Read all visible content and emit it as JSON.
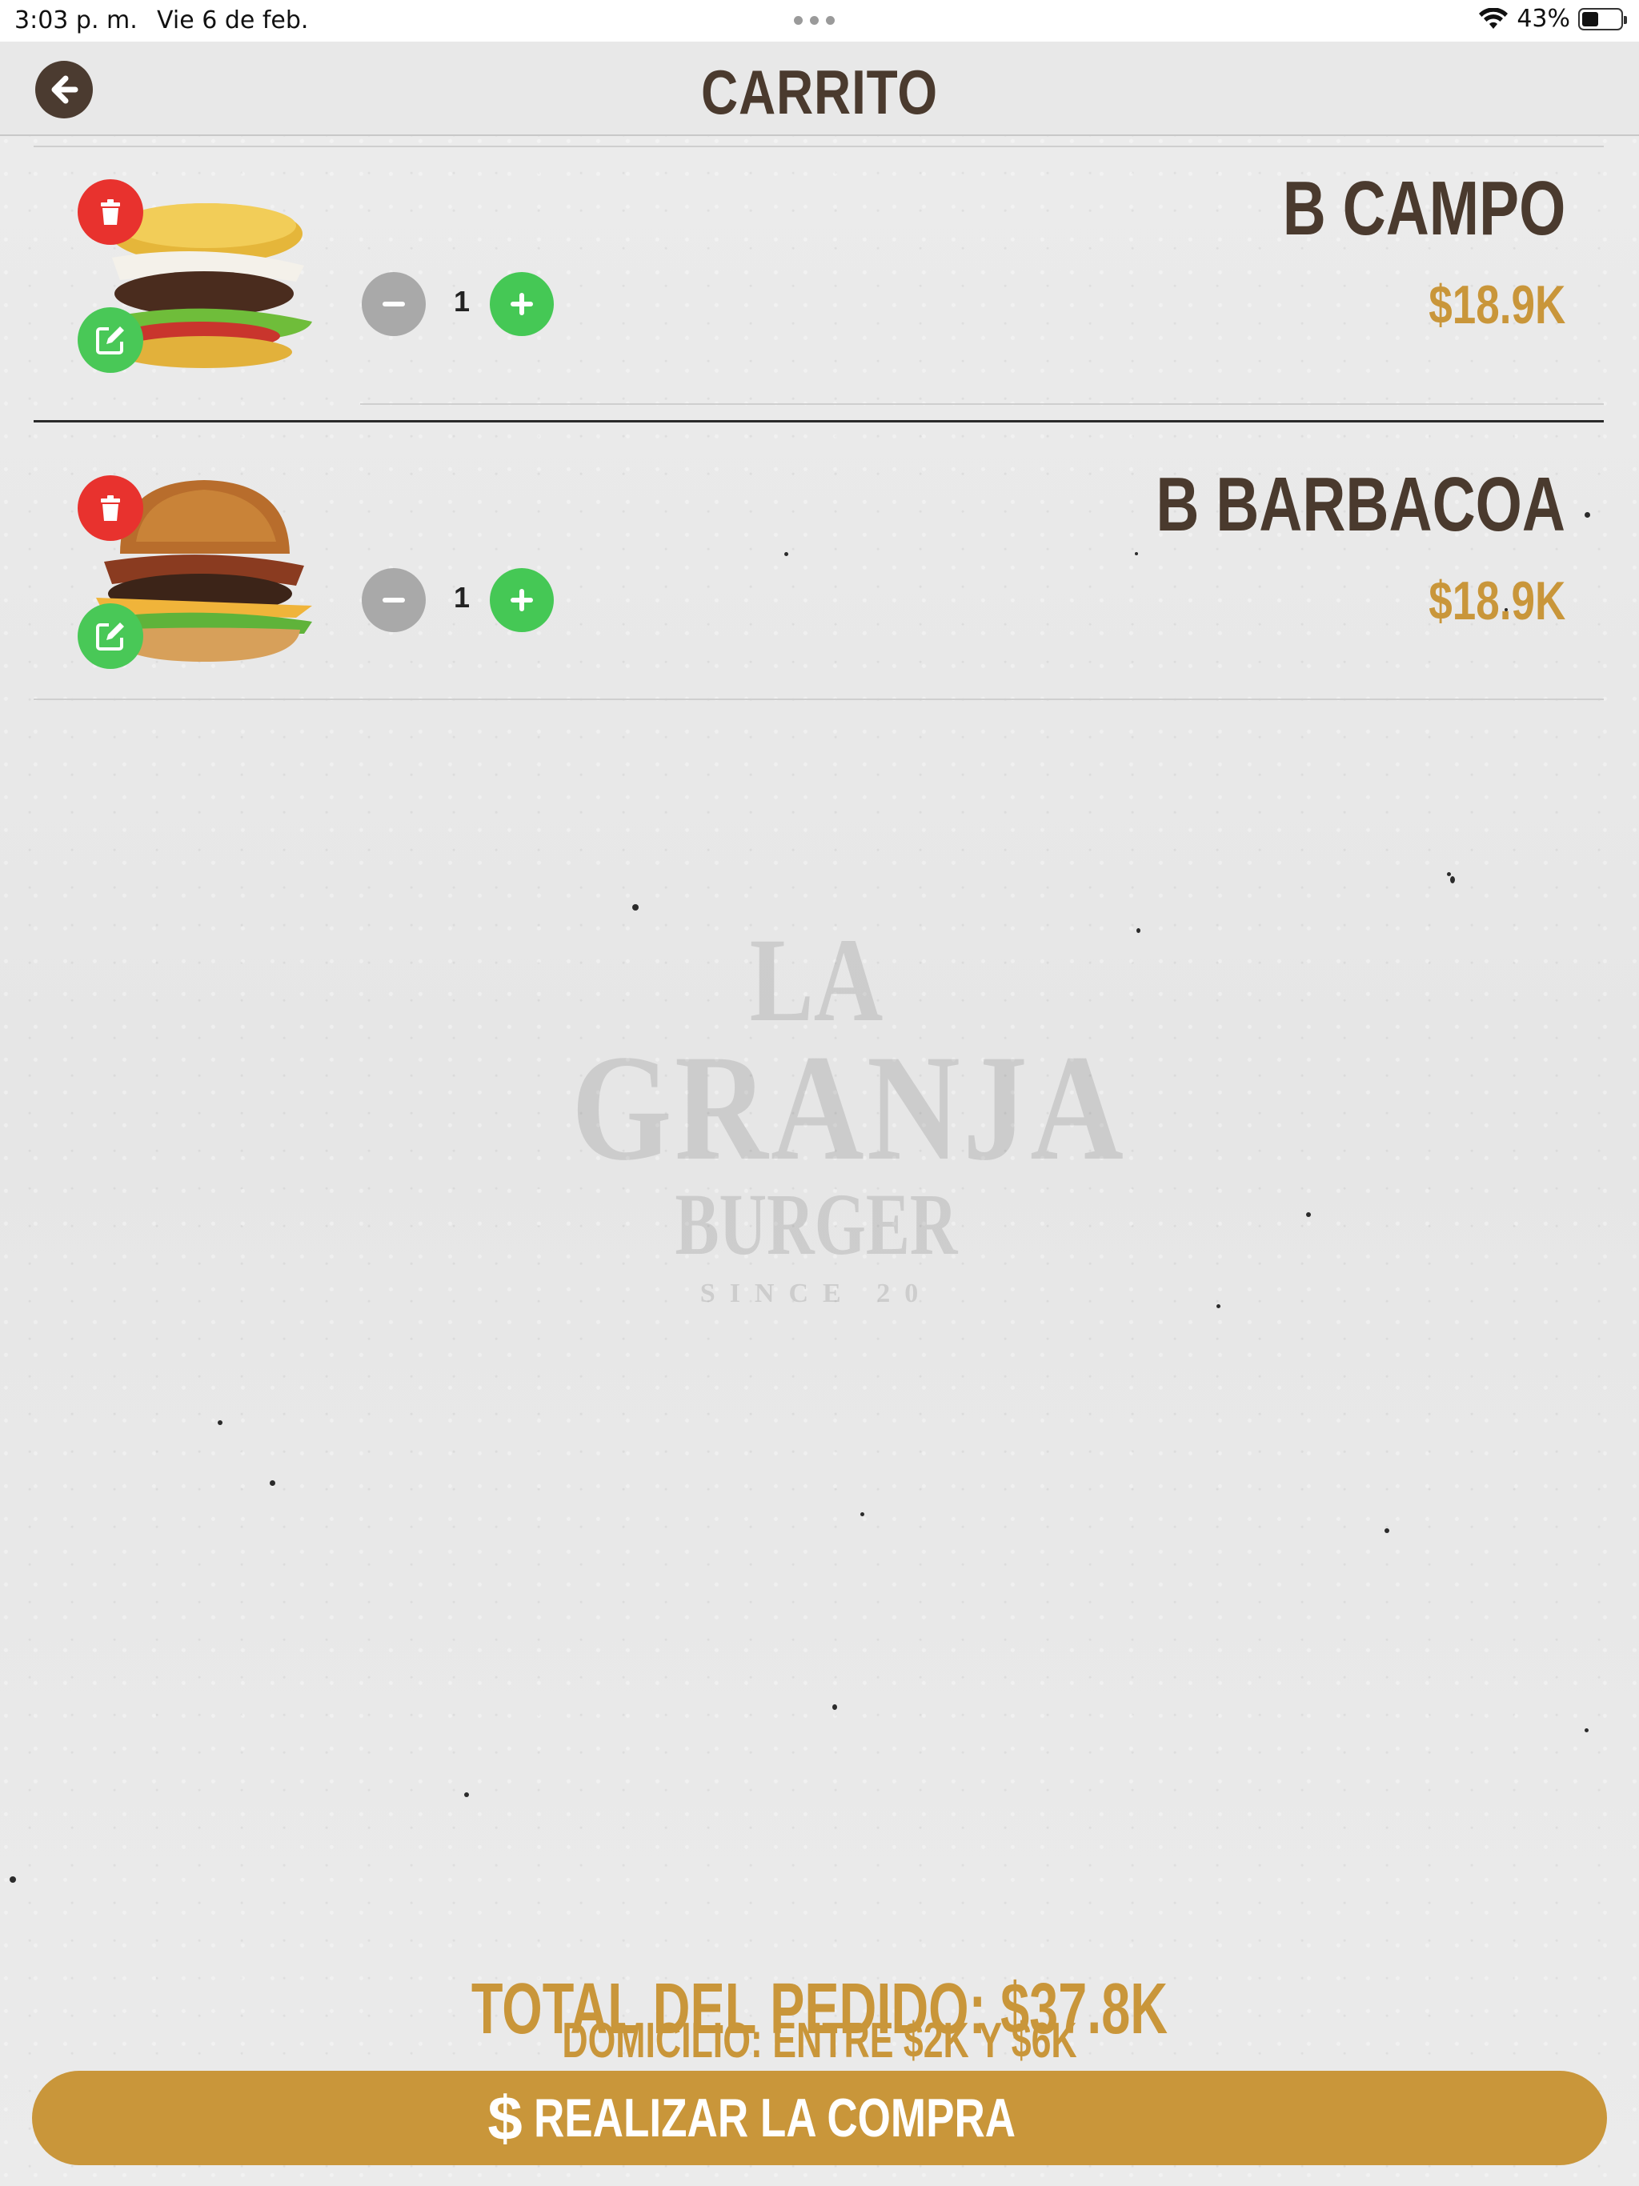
{
  "status_bar": {
    "time": "3:03 p. m.",
    "date": "Vie 6 de feb.",
    "battery_percent": "43%",
    "battery_level": 0.43
  },
  "header": {
    "title": "CARRITO",
    "back_icon": "arrow-left-icon"
  },
  "cart": {
    "items": [
      {
        "name": "B CAMPO",
        "price": "$18.9K",
        "quantity": "1"
      },
      {
        "name": "B BARBACOA",
        "price": "$18.9K",
        "quantity": "1"
      }
    ]
  },
  "watermark": {
    "line1": "LA",
    "line2": "GRANJA",
    "line3": "BURGER",
    "line4": "SINCE 20"
  },
  "footer": {
    "total": "TOTAL DEL PEDIDO: $37.8K",
    "delivery": "DOMICILIO: ENTRE $2K Y $6K",
    "buy_icon": "$",
    "buy_label": "REALIZAR LA COMPRA"
  },
  "colors": {
    "accent": "#c9963a",
    "brown": "#4a3a2e",
    "delete": "#e8322e",
    "add": "#45c855",
    "disabled": "#a9a9a9"
  }
}
